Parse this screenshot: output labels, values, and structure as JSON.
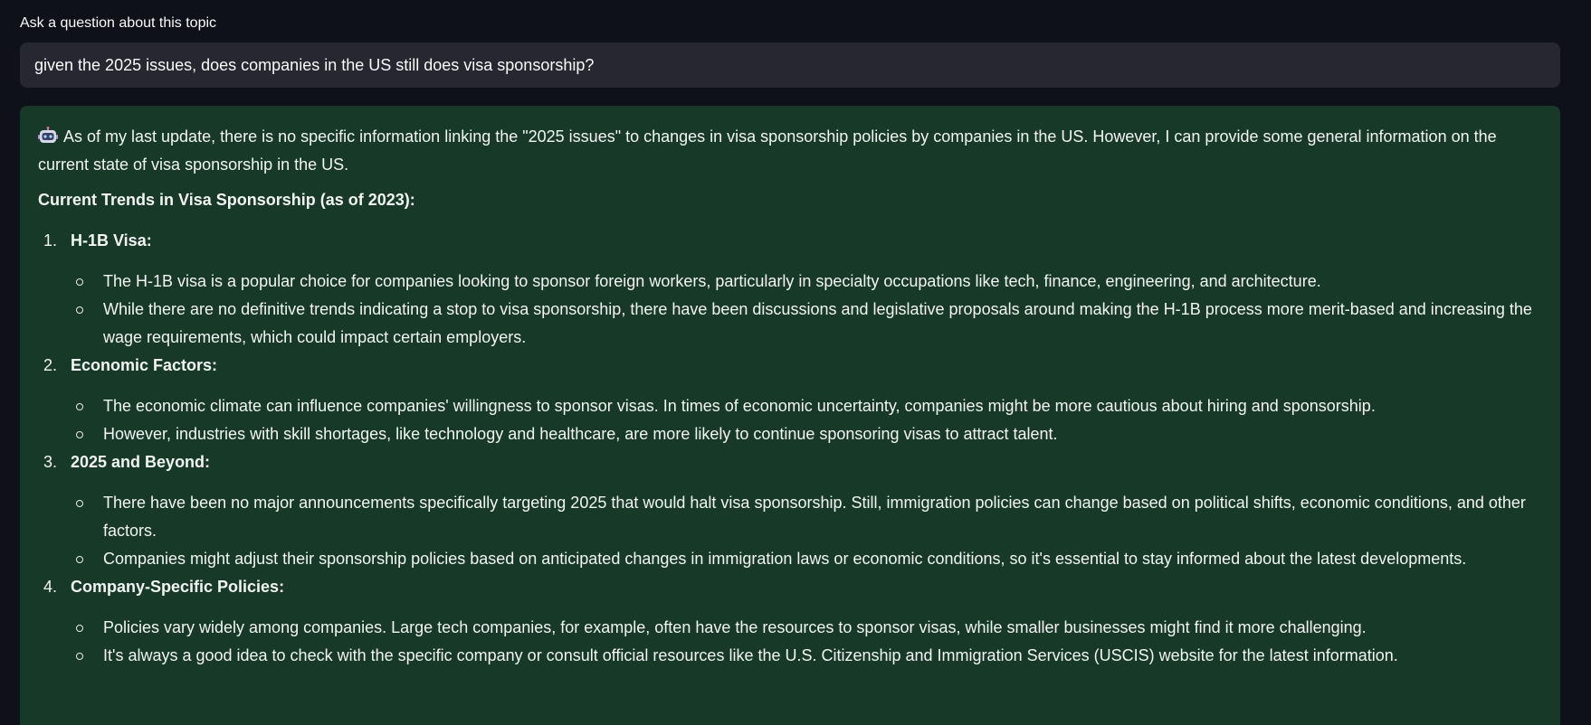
{
  "question": {
    "label": "Ask a question about this topic",
    "value": "given the 2025 issues, does companies in the US still does visa sponsorship?"
  },
  "answer": {
    "avatar_icon": "robot-icon",
    "intro": "As of my last update, there is no specific information linking the \"2025 issues\" to changes in visa sponsorship policies by companies in the US. However, I can provide some general information on the current state of visa sponsorship in the US.",
    "heading": "Current Trends in Visa Sponsorship (as of 2023):",
    "items": [
      {
        "number": "1.",
        "title": "H-1B Visa:",
        "bullets": [
          "The H-1B visa is a popular choice for companies looking to sponsor foreign workers, particularly in specialty occupations like tech, finance, engineering, and architecture.",
          "While there are no definitive trends indicating a stop to visa sponsorship, there have been discussions and legislative proposals around making the H-1B process more merit-based and increasing the wage requirements, which could impact certain employers."
        ]
      },
      {
        "number": "2.",
        "title": "Economic Factors:",
        "bullets": [
          "The economic climate can influence companies' willingness to sponsor visas. In times of economic uncertainty, companies might be more cautious about hiring and sponsorship.",
          "However, industries with skill shortages, like technology and healthcare, are more likely to continue sponsoring visas to attract talent."
        ]
      },
      {
        "number": "3.",
        "title": "2025 and Beyond:",
        "bullets": [
          "There have been no major announcements specifically targeting 2025 that would halt visa sponsorship. Still, immigration policies can change based on political shifts, economic conditions, and other factors.",
          "Companies might adjust their sponsorship policies based on anticipated changes in immigration laws or economic conditions, so it's essential to stay informed about the latest developments."
        ]
      },
      {
        "number": "4.",
        "title": "Company-Specific Policies:",
        "bullets": [
          "Policies vary widely among companies. Large tech companies, for example, often have the resources to sponsor visas, while smaller businesses might find it more challenging.",
          "It's always a good idea to check with the specific company or consult official resources like the U.S. Citizenship and Immigration Services (USCIS) website for the latest information."
        ]
      }
    ]
  },
  "colors": {
    "background": "#0e1117",
    "input_background": "#262730",
    "answer_background": "#173928"
  }
}
